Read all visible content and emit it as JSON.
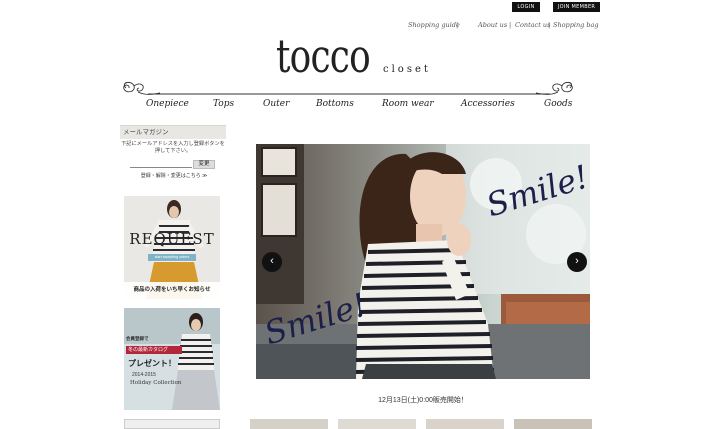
{
  "account": {
    "login": "LOGIN",
    "join": "JOIN MEMBER"
  },
  "utility_links": [
    "Shopping guide",
    "About us",
    "Contact us",
    "Shopping bag"
  ],
  "brand": {
    "name": "tocco",
    "sub": "closet"
  },
  "nav": [
    "Onepiece",
    "Tops",
    "Outer",
    "Bottoms",
    "Room wear",
    "Accessories",
    "Goods"
  ],
  "sidebar": {
    "mail_title": "メールマガジン",
    "mail_desc": "下記にメールアドレスを入力し登録ボタンを押して下さい。",
    "mail_button": "変更",
    "mail_note": "登録・解除・変更はこちら ≫",
    "request_banner": {
      "title": "REQUEST",
      "tag": "start accepting orders",
      "text": "商品の入荷をいち早くお知らせ"
    },
    "catalog_banner": {
      "tag1": "会員登録で",
      "tag2": "冬の最新カタログ",
      "present": "プレゼント！",
      "years": "2014-2015",
      "subtitle": "Holiday Collection"
    }
  },
  "slider": {
    "headline": "Smile!",
    "prev": "‹",
    "next": "›"
  },
  "caption": "12月13日(土)0:00販売開始！",
  "colors": {
    "accent": "#111111",
    "nav_text": "#222222",
    "sidebar_head": "#e9e7e3",
    "catalog_tag": "#b3273a"
  }
}
